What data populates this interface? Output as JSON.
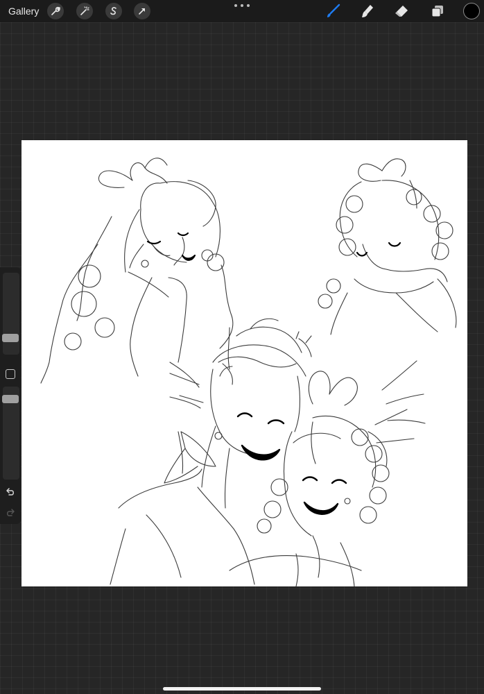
{
  "toolbar": {
    "gallery_label": "Gallery",
    "left_tools": [
      "wrench-icon",
      "magic-wand-icon",
      "selection-s-icon",
      "transform-arrow-icon"
    ],
    "right_tools": [
      "brush-icon",
      "smudge-icon",
      "eraser-icon",
      "layers-icon"
    ],
    "active_tool": "brush",
    "active_color": "#000000",
    "accent_color": "#1e7cf2"
  },
  "sidebar": {
    "brush_size_level": 0.13,
    "opacity_level": 0.9,
    "buttons": [
      "modify-button",
      "undo-icon",
      "redo-icon"
    ]
  },
  "canvas": {
    "background": "#ffffff"
  }
}
